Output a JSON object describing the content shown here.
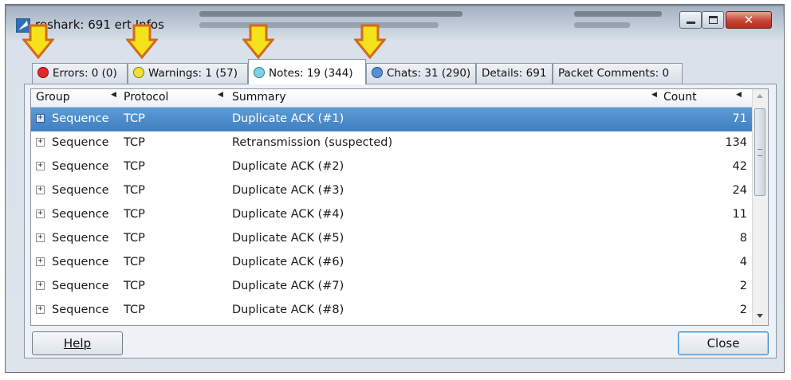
{
  "window": {
    "title": "reshark: 691 ert Infos"
  },
  "tabs": [
    {
      "label": "Errors: 0 (0)",
      "dot_color": "#e02a2a",
      "active": false
    },
    {
      "label": "Warnings: 1 (57)",
      "dot_color": "#f0e03a",
      "active": false
    },
    {
      "label": "Notes: 19 (344)",
      "dot_color": "#7fd0e6",
      "active": true
    },
    {
      "label": "Chats: 31 (290)",
      "dot_color": "#5a8fd6",
      "active": false
    },
    {
      "label": "Details: 691",
      "dot_color": "",
      "active": false
    },
    {
      "label": "Packet Comments: 0",
      "dot_color": "",
      "active": false
    }
  ],
  "columns": {
    "group": "Group",
    "protocol": "Protocol",
    "summary": "Summary",
    "count": "Count"
  },
  "rows": [
    {
      "group": "Sequence",
      "protocol": "TCP",
      "summary": "Duplicate ACK (#1)",
      "count": "71",
      "selected": true
    },
    {
      "group": "Sequence",
      "protocol": "TCP",
      "summary": "Retransmission (suspected)",
      "count": "134"
    },
    {
      "group": "Sequence",
      "protocol": "TCP",
      "summary": "Duplicate ACK (#2)",
      "count": "42"
    },
    {
      "group": "Sequence",
      "protocol": "TCP",
      "summary": "Duplicate ACK (#3)",
      "count": "24"
    },
    {
      "group": "Sequence",
      "protocol": "TCP",
      "summary": "Duplicate ACK (#4)",
      "count": "11"
    },
    {
      "group": "Sequence",
      "protocol": "TCP",
      "summary": "Duplicate ACK (#5)",
      "count": "8"
    },
    {
      "group": "Sequence",
      "protocol": "TCP",
      "summary": "Duplicate ACK (#6)",
      "count": "4"
    },
    {
      "group": "Sequence",
      "protocol": "TCP",
      "summary": "Duplicate ACK (#7)",
      "count": "2"
    },
    {
      "group": "Sequence",
      "protocol": "TCP",
      "summary": "Duplicate ACK (#8)",
      "count": "2"
    }
  ],
  "buttons": {
    "help": "Help",
    "close": "Close"
  },
  "icons": {
    "app": "wireshark-fin-icon",
    "annotation": "yellow-down-arrow-icon",
    "expand": "plus-box-icon",
    "sort": "sort-arrow-icon"
  },
  "colors": {
    "selection": "#4a8ccc",
    "arrow_fill": "#f6e21a",
    "arrow_stroke": "#d4691c"
  }
}
